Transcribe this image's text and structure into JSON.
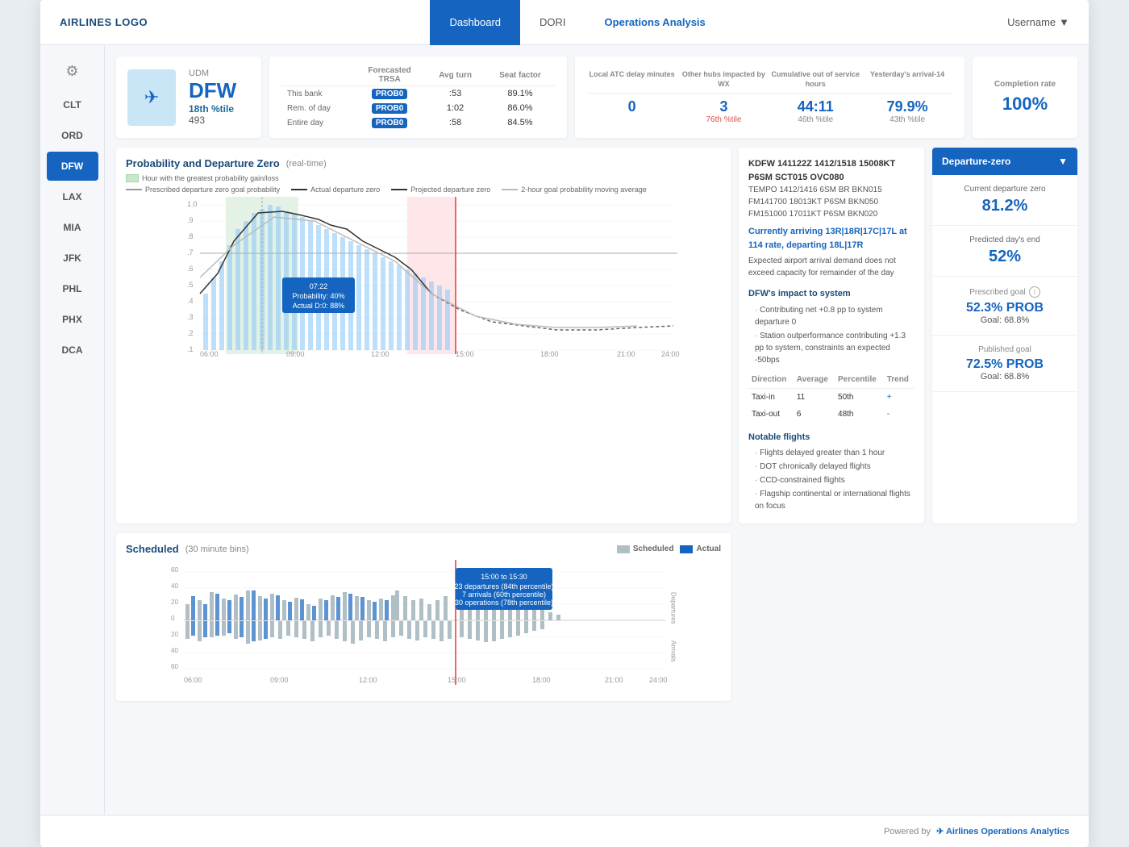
{
  "nav": {
    "logo": "AIRLINES LOGO",
    "tabs": [
      {
        "label": "Dashboard",
        "active": true
      },
      {
        "label": "DORI",
        "active": false
      },
      {
        "label": "Operations Analysis",
        "active": false,
        "highlight": true
      }
    ],
    "user": "Username"
  },
  "sidebar": {
    "icon": "⚙",
    "stations": [
      "CLT",
      "ORD",
      "DFW",
      "LAX",
      "MIA",
      "JFK",
      "PHL",
      "PHX",
      "DCA"
    ]
  },
  "dfw_card": {
    "airport": "DFW",
    "label": "UDM",
    "percentile": "18th %tile",
    "number": "493"
  },
  "trsa": {
    "title": "Forecasted TRSA",
    "col2": "Avg turn",
    "col3": "Seat factor",
    "rows": [
      {
        "label": "This bank",
        "col1": "PROB0",
        "col2": ":53",
        "col3": "89.1%"
      },
      {
        "label": "Rem. of day",
        "col1": "PROB0",
        "col2": "1:02",
        "col3": "86.0%"
      },
      {
        "label": "Entire day",
        "col1": "PROB0",
        "col2": ":58",
        "col3": "84.5%"
      }
    ]
  },
  "local_atc": {
    "headers": [
      "Local ATC delay minutes",
      "Other hubs impacted by WX",
      "Cumulative out of service hours",
      "Yesterday's arrival-14"
    ],
    "values": [
      "0",
      "3",
      "44:11",
      "79.9%"
    ],
    "subs": [
      "",
      "76th %tile",
      "46th %tile",
      "43th %tile"
    ],
    "sub_styles": [
      "",
      "red",
      "gray",
      "gray"
    ]
  },
  "completion": {
    "label": "Completion rate",
    "value": "100%"
  },
  "prob_chart": {
    "title": "Probability and Departure Zero",
    "subtitle": "(real-time)",
    "legend_hour": "Hour with the greatest probability gain/loss",
    "legend_items": [
      {
        "label": "Prescribed departure zero goal probability",
        "style": "solid",
        "color": "#999"
      },
      {
        "label": "Actual departure zero",
        "style": "solid",
        "color": "#333"
      },
      {
        "label": "Projected departure zero",
        "style": "dashed",
        "color": "#333"
      },
      {
        "label": "2-hour goal probability moving average",
        "style": "solid",
        "color": "#bbb"
      }
    ],
    "tooltip": {
      "time": "07:22",
      "probability": "Probability: 40%",
      "actual": "Actual D:0: 88%"
    }
  },
  "metar": {
    "code": "KDFW 141122Z 1412/1518 15008KT P6SM SCT015 OVC080",
    "lines": [
      "TEMPO 1412/1416 6SM BR BKN015",
      "FM141700 18013KT P6SM BKN050",
      "FM151000 17011KT P6SM BKN020"
    ],
    "runway_text": "Currently arriving 13R|18R|17C|17L at 114 rate, departing 18L|17R",
    "capacity_text": "Expected airport arrival demand does not exceed capacity for remainder of the day",
    "impact_title": "DFW's impact to system",
    "impact_bullets": [
      "Contributing net +0.8 pp to system departure 0",
      "Station outperformance contributing +1.3 pp to system, constraints an expected -50bps"
    ],
    "table": {
      "headers": [
        "Direction",
        "Average",
        "Percentile",
        "Trend"
      ],
      "rows": [
        [
          "Taxi-in",
          "11",
          "50th",
          "+"
        ],
        [
          "Taxi-out",
          "6",
          "48th",
          "-"
        ]
      ]
    },
    "notable_title": "Notable flights",
    "notable_bullets": [
      "Flights delayed greater than 1 hour",
      "DOT chronically delayed flights",
      "CCD-constrained flights",
      "Flagship continental or international flights on focus"
    ]
  },
  "departure_panel": {
    "header": "Departure-zero",
    "sections": [
      {
        "label": "Current departure zero",
        "value": "81.2%"
      },
      {
        "label": "Predicted day's end",
        "value": "52%"
      },
      {
        "label": "Prescribed goal",
        "info": true,
        "prob_value": "52.3% PROB",
        "goal_value": "Goal: 68.8%"
      },
      {
        "label": "Published goal",
        "info": false,
        "prob_value": "72.5% PROB",
        "goal_value": "Goal: 68.8%"
      }
    ]
  },
  "scheduled_chart": {
    "title": "Scheduled",
    "subtitle": "(30 minute bins)",
    "legend_scheduled": "Scheduled",
    "legend_actual": "Actual",
    "tooltip": {
      "time_range": "15:00 to 15:30",
      "line1": "23 departures (84th percentile)",
      "line2": "7 arrivals (60th percentile)",
      "line3": "30 operations (78th percentile)"
    }
  },
  "footer": {
    "powered_by": "Powered by",
    "brand": "Airlines Operations Analytics"
  }
}
